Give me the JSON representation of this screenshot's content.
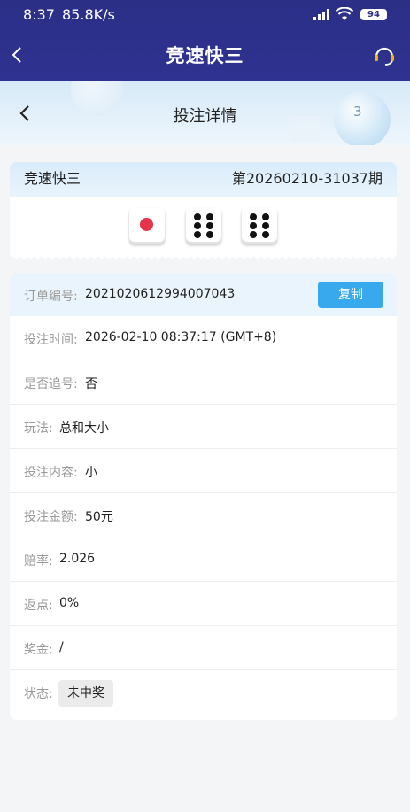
{
  "status_bar": {
    "time": "8:37",
    "speed": "85.8K/s",
    "battery": "94"
  },
  "app_header": {
    "title": "竞速快三"
  },
  "page_header": {
    "title": "投注详情",
    "ball_number": "3"
  },
  "result": {
    "game_name": "竞速快三",
    "period": "第20260210-31037期",
    "dice": [
      1,
      6,
      6
    ]
  },
  "details": {
    "order_label": "订单编号:",
    "order_value": "2021020612994007043",
    "copy_label": "复制",
    "time_label": "投注时间:",
    "time_value": "2026-02-10 08:37:17 (GMT+8)",
    "chase_label": "是否追号:",
    "chase_value": "否",
    "play_label": "玩法:",
    "play_value": "总和大小",
    "content_label": "投注内容:",
    "content_value": "小",
    "amount_label": "投注金额:",
    "amount_value": "50元",
    "odds_label": "赔率:",
    "odds_value": "2.026",
    "rebate_label": "返点:",
    "rebate_value": "0%",
    "prize_label": "奖金:",
    "prize_value": "/",
    "state_label": "状态:",
    "state_value": "未中奖"
  },
  "colors": {
    "header_bg": "#2c2f86",
    "accent": "#39a9ee",
    "die_red": "#e8324a"
  }
}
